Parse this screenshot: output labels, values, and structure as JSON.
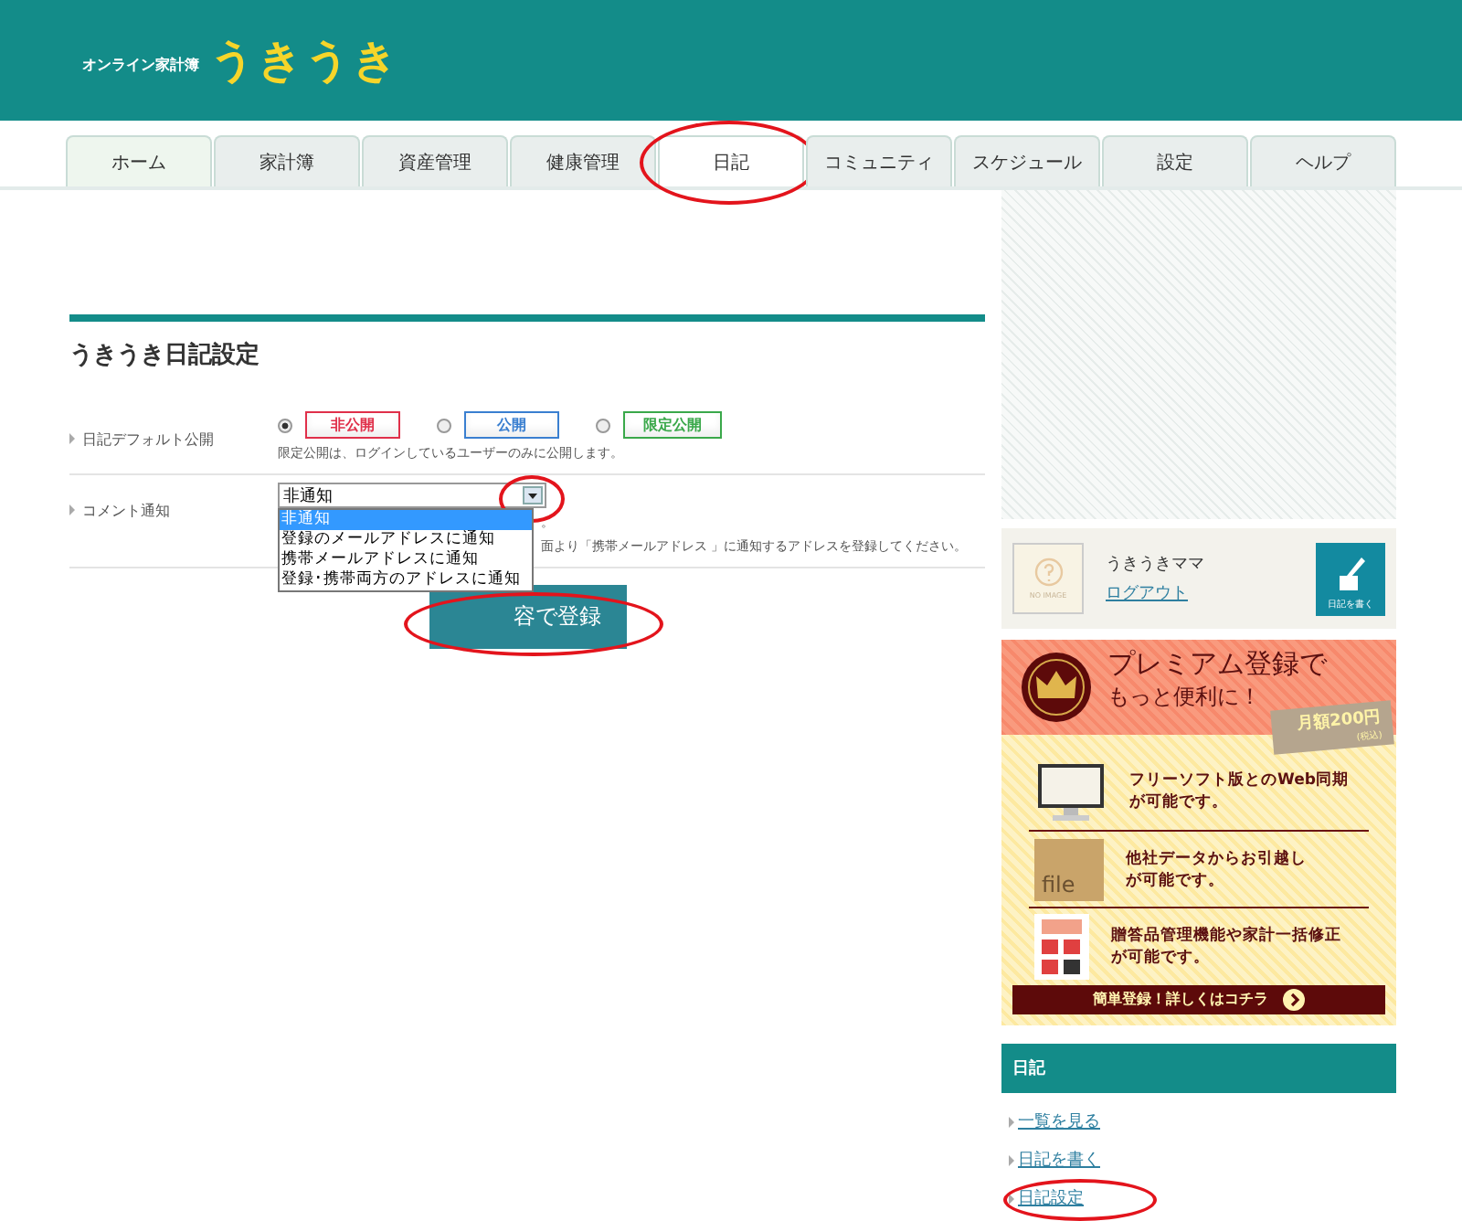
{
  "header": {
    "tagline": "オンライン家計簿",
    "logo": "うきうき"
  },
  "tabs": [
    {
      "label": "ホーム",
      "selected": false,
      "circled": false
    },
    {
      "label": "家計簿",
      "selected": false,
      "circled": false
    },
    {
      "label": "資産管理",
      "selected": false,
      "circled": false
    },
    {
      "label": "健康管理",
      "selected": false,
      "circled": false
    },
    {
      "label": "日記",
      "selected": true,
      "circled": true
    },
    {
      "label": "コミュニティ",
      "selected": false,
      "circled": false
    },
    {
      "label": "スケジュール",
      "selected": false,
      "circled": false
    },
    {
      "label": "設定",
      "selected": false,
      "circled": false
    },
    {
      "label": "ヘルプ",
      "selected": false,
      "circled": false
    }
  ],
  "settings": {
    "title": "うきうき日記設定",
    "visibility": {
      "label": "日記デフォルト公開",
      "options": [
        {
          "label": "非公開",
          "selected": true,
          "color": "#e0304a"
        },
        {
          "label": "公開",
          "selected": false,
          "color": "#3a7fd0"
        },
        {
          "label": "限定公開",
          "selected": false,
          "color": "#3aa84a"
        }
      ],
      "note": "限定公開は、ログインしているユーザーのみに公開します。"
    },
    "comment": {
      "label": "コメント通知",
      "value": "非通知",
      "expanded": true,
      "circled": true,
      "options": [
        {
          "label": "非通知",
          "selected": true
        },
        {
          "label": "登録のメールアドレスに通知",
          "selected": false
        },
        {
          "label": "携帯メールアドレスに通知",
          "selected": false
        },
        {
          "label": "登録･携帯両方のアドレスに通知",
          "selected": false
        }
      ],
      "note_lines": [
        "。",
        "面より「携帯メールアドレス 」に通知するアドレスを登録してください。"
      ]
    },
    "submit": {
      "label": "容で登録",
      "circled": true
    }
  },
  "user": {
    "avatar_text": "NO IMAGE",
    "name": "うきうきママ",
    "logout": "ログアウト",
    "write_button": "日記を書く"
  },
  "premium": {
    "title": "プレミアム登録で",
    "subtitle": "もっと便利に！",
    "price": "月額200円",
    "tax": "(税込)",
    "features": [
      {
        "kind": "monitor",
        "lines": [
          "フリーソフト版とのWeb同期",
          "が可能です。"
        ]
      },
      {
        "kind": "folder",
        "lines": [
          "他社データからお引越し",
          "が可能です。"
        ],
        "icon_text": "file"
      },
      {
        "kind": "calculator",
        "lines": [
          "贈答品管理機能や家計一括修正",
          "が可能です。"
        ]
      }
    ],
    "cta": "簡単登録！詳しくはコチラ"
  },
  "diary_menu": {
    "title": "日記",
    "links": [
      {
        "label": "一覧を見る",
        "circled": false
      },
      {
        "label": "日記を書く",
        "circled": false
      },
      {
        "label": "日記設定",
        "circled": true
      }
    ]
  }
}
